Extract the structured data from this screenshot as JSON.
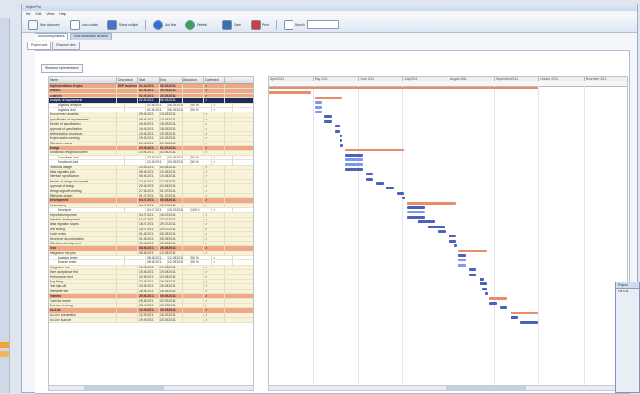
{
  "window": {
    "title": "Project Pro"
  },
  "menu": [
    "File",
    "Edit",
    "Views",
    "Help"
  ],
  "toolbar": [
    {
      "label": "New document",
      "icon": "document-icon",
      "color": "#f4f4f4"
    },
    {
      "label": "Auto update",
      "icon": "refresh-icon",
      "color": "#ffffff"
    },
    {
      "label": "Select multiple",
      "icon": "calendar-icon",
      "color": "#4a73c7"
    },
    {
      "label": "Add line",
      "icon": "globe-icon",
      "color": "#2f6fd1"
    },
    {
      "label": "Refresh",
      "icon": "refresh-green-icon",
      "color": "#2ea84a"
    },
    {
      "label": "Save",
      "icon": "save-icon",
      "color": "#3b6fb0"
    },
    {
      "label": "Print",
      "icon": "print-icon",
      "color": "#d23c3c"
    },
    {
      "label": "Search",
      "icon": "search-icon",
      "color": "#ffffff"
    }
  ],
  "tabs": [
    {
      "label": "Microsoft Dynamics",
      "active": true
    },
    {
      "label": "Work breakdown structure",
      "active": false
    }
  ],
  "subtabs": [
    {
      "label": "Project view",
      "active": true
    },
    {
      "label": "Resource view",
      "active": false
    }
  ],
  "filter": {
    "label": "Standard implementation"
  },
  "columns": [
    "Name",
    "Description",
    "Start",
    "End",
    "Allocation",
    "Confirmed"
  ],
  "rows": [
    {
      "type": "phase",
      "cells": [
        "Implementation Project",
        "ERP Implementation",
        "01.04.2011",
        "30.09.2011",
        "",
        "✓"
      ]
    },
    {
      "type": "phase",
      "cells": [
        "Phase 1",
        "",
        "01.04.2011",
        "29.04.2011",
        "",
        "✓"
      ]
    },
    {
      "type": "phase",
      "cells": [
        "Analysis",
        "",
        "02.05.2011",
        "20.05.2011",
        "",
        "✓"
      ]
    },
    {
      "type": "sel",
      "cells": [
        "Analysis of requirements",
        "",
        "02.05.2011",
        "06.05.2011",
        "",
        "✓"
      ]
    },
    {
      "type": "sub",
      "cells": [
        "Logistics analysis",
        "",
        "02.05.2011",
        "06.05.2011",
        "50 %",
        "✓"
      ]
    },
    {
      "type": "sub",
      "cells": [
        "Logistics lead",
        "",
        "02.05.2011",
        "06.05.2011",
        "50 %",
        "✓"
      ]
    },
    {
      "type": "task",
      "cells": [
        "Procurement analysis",
        "",
        "09.05.2011",
        "13.05.2011",
        "",
        "✓"
      ]
    },
    {
      "type": "task",
      "cells": [
        "Specification of requirements",
        "",
        "09.05.2011",
        "13.05.2011",
        "",
        "✓"
      ]
    },
    {
      "type": "task",
      "cells": [
        "Review of specification",
        "",
        "16.05.2011",
        "18.05.2011",
        "",
        "✓"
      ]
    },
    {
      "type": "task",
      "cells": [
        "Approval of specification",
        "",
        "16.05.2011",
        "18.05.2011",
        "",
        "✓"
      ]
    },
    {
      "type": "task",
      "cells": [
        "Define logistic processes",
        "",
        "19.05.2011",
        "20.05.2011",
        "",
        "✓"
      ]
    },
    {
      "type": "task",
      "cells": [
        "Project status meeting",
        "",
        "19.05.2011",
        "20.05.2011",
        "",
        "✓"
      ]
    },
    {
      "type": "task",
      "cells": [
        "Milestone review",
        "",
        "20.05.2011",
        "20.05.2011",
        "",
        "✓"
      ]
    },
    {
      "type": "phase",
      "cells": [
        "Design",
        "",
        "23.05.2011",
        "01.07.2011",
        "",
        "✓"
      ]
    },
    {
      "type": "task",
      "cells": [
        "Functional design document",
        "",
        "23.05.2011",
        "03.06.2011",
        "",
        "✓"
      ]
    },
    {
      "type": "sub",
      "cells": [
        "Consultant lead",
        "",
        "23.05.2011",
        "03.06.2011",
        "50 %",
        "✓"
      ]
    },
    {
      "type": "sub",
      "cells": [
        "Functional lead",
        "",
        "23.05.2011",
        "03.06.2011",
        "50 %",
        "✓"
      ]
    },
    {
      "type": "task",
      "cells": [
        "Technical design",
        "",
        "23.05.2011",
        "03.06.2011",
        "",
        "✓"
      ]
    },
    {
      "type": "task",
      "cells": [
        "Data migration plan",
        "",
        "06.06.2011",
        "10.06.2011",
        "",
        "✓"
      ]
    },
    {
      "type": "task",
      "cells": [
        "Interface specification",
        "",
        "06.06.2011",
        "10.06.2011",
        "",
        "✓"
      ]
    },
    {
      "type": "task",
      "cells": [
        "Review of design documents",
        "",
        "13.06.2011",
        "17.06.2011",
        "",
        "✓"
      ]
    },
    {
      "type": "task",
      "cells": [
        "Approval of design",
        "",
        "20.06.2011",
        "24.06.2011",
        "",
        "✓"
      ]
    },
    {
      "type": "task",
      "cells": [
        "Design sign-off meeting",
        "",
        "27.06.2011",
        "01.07.2011",
        "",
        "✓"
      ]
    },
    {
      "type": "task",
      "cells": [
        "Milestone design",
        "",
        "01.07.2011",
        "01.07.2011",
        "",
        "✓"
      ]
    },
    {
      "type": "phase",
      "cells": [
        "Development",
        "",
        "04.07.2011",
        "05.08.2011",
        "",
        "✓"
      ]
    },
    {
      "type": "task",
      "cells": [
        "Customising",
        "",
        "04.07.2011",
        "15.07.2011",
        "",
        "✓"
      ]
    },
    {
      "type": "sub",
      "cells": [
        "Developer",
        "",
        "04.07.2011",
        "15.07.2011",
        "100 %",
        "✓"
      ]
    },
    {
      "type": "task",
      "cells": [
        "Report development",
        "",
        "04.07.2011",
        "15.07.2011",
        "",
        "✓"
      ]
    },
    {
      "type": "task",
      "cells": [
        "Interface development",
        "",
        "11.07.2011",
        "22.07.2011",
        "",
        "✓"
      ]
    },
    {
      "type": "task",
      "cells": [
        "Data migration scripts",
        "",
        "18.07.2011",
        "29.07.2011",
        "",
        "✓"
      ]
    },
    {
      "type": "task",
      "cells": [
        "Unit testing",
        "",
        "25.07.2011",
        "29.07.2011",
        "",
        "✓"
      ]
    },
    {
      "type": "task",
      "cells": [
        "Code review",
        "",
        "01.08.2011",
        "05.08.2011",
        "",
        "✓"
      ]
    },
    {
      "type": "task",
      "cells": [
        "Developer documentation",
        "",
        "01.08.2011",
        "05.08.2011",
        "",
        "✓"
      ]
    },
    {
      "type": "task",
      "cells": [
        "Milestone development",
        "",
        "05.08.2011",
        "05.08.2011",
        "",
        "✓"
      ]
    },
    {
      "type": "phase",
      "cells": [
        "Test",
        "",
        "08.08.2011",
        "26.08.2011",
        "",
        "✓"
      ]
    },
    {
      "type": "task",
      "cells": [
        "Integration test plan",
        "",
        "08.08.2011",
        "12.08.2011",
        "",
        "✓"
      ]
    },
    {
      "type": "sub",
      "cells": [
        "Logistics tester",
        "",
        "08.08.2011",
        "12.08.2011",
        "50 %",
        "✓"
      ]
    },
    {
      "type": "sub",
      "cells": [
        "Finance tester",
        "",
        "08.08.2011",
        "12.08.2011",
        "50 %",
        "✓"
      ]
    },
    {
      "type": "task",
      "cells": [
        "Integration test",
        "",
        "15.08.2011",
        "19.08.2011",
        "",
        "✓"
      ]
    },
    {
      "type": "task",
      "cells": [
        "User acceptance test",
        "",
        "15.08.2011",
        "19.08.2011",
        "",
        "✓"
      ]
    },
    {
      "type": "task",
      "cells": [
        "Performance test",
        "",
        "22.08.2011",
        "24.08.2011",
        "",
        "✓"
      ]
    },
    {
      "type": "task",
      "cells": [
        "Bug fixing",
        "",
        "22.08.2011",
        "26.08.2011",
        "",
        "✓"
      ]
    },
    {
      "type": "task",
      "cells": [
        "Test sign-off",
        "",
        "24.08.2011",
        "26.08.2011",
        "",
        "✓"
      ]
    },
    {
      "type": "task",
      "cells": [
        "Milestone test",
        "",
        "26.08.2011",
        "26.08.2011",
        "",
        "✓"
      ]
    },
    {
      "type": "phase",
      "cells": [
        "Training",
        "",
        "29.08.2011",
        "09.09.2011",
        "",
        "✓"
      ]
    },
    {
      "type": "task",
      "cells": [
        "Train the trainer",
        "",
        "29.08.2011",
        "02.09.2011",
        "",
        "✓"
      ]
    },
    {
      "type": "task",
      "cells": [
        "End user training",
        "",
        "05.09.2011",
        "09.09.2011",
        "",
        "✓"
      ]
    },
    {
      "type": "phase",
      "cells": [
        "Go-Live",
        "",
        "12.09.2011",
        "30.09.2011",
        "",
        "✓"
      ]
    },
    {
      "type": "task",
      "cells": [
        "Go-Live preparation",
        "",
        "12.09.2011",
        "16.09.2011",
        "",
        "✓"
      ]
    },
    {
      "type": "task",
      "cells": [
        "Go-Live support",
        "",
        "19.09.2011",
        "30.09.2011",
        "",
        "✓"
      ]
    }
  ],
  "timeline": {
    "months": [
      "April 2011",
      "May 2011",
      "June 2011",
      "July 2011",
      "August 2011",
      "September 2011",
      "October 2011",
      "November 2011"
    ],
    "start": "2011-04-01",
    "end": "2011-11-30"
  },
  "colors": {
    "summary": "#e68e6a",
    "task": "#4a63b8",
    "selected_row": "#1f2a5c",
    "phase_row": "#f0a785"
  },
  "inset_window": {
    "title": "Project",
    "menu": "File Edit"
  }
}
